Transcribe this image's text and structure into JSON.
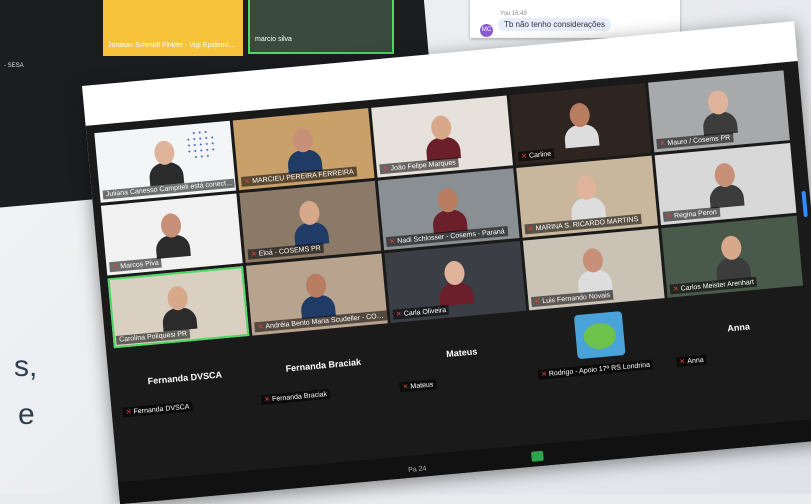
{
  "background": {
    "thumb1_label": "Jonatan Schmidt Finkler - Vigi Epidemi...",
    "thumb2_label": "marcio silva",
    "sesa_label": "- SESA",
    "left_text_line1": "s,",
    "left_text_line2": "e",
    "chat_small": "You 16:49",
    "chat_message": "Tb não tenho considerações",
    "chat_avatar": "MC"
  },
  "participants": [
    {
      "name": "Juliana Canesso Campiteli está conect...",
      "mic_muted": false,
      "type": "logo"
    },
    {
      "name": "MARCIEU PEREIRA FERREIRA",
      "mic_muted": true,
      "type": "video"
    },
    {
      "name": "João Felipe Marques",
      "mic_muted": true,
      "type": "video"
    },
    {
      "name": "Carline",
      "mic_muted": true,
      "type": "video"
    },
    {
      "name": "Mauro / Cosems PR",
      "mic_muted": true,
      "type": "video"
    },
    {
      "name": "Marcos Piva",
      "mic_muted": true,
      "type": "video"
    },
    {
      "name": "Eloá - COSEMS PR",
      "mic_muted": true,
      "type": "video"
    },
    {
      "name": "Nadi Schlosser - Cosems - Paraná",
      "mic_muted": true,
      "type": "video"
    },
    {
      "name": "MARINA S. RICARDO MARTINS",
      "mic_muted": true,
      "type": "video"
    },
    {
      "name": "Regina Peron",
      "mic_muted": true,
      "type": "video"
    },
    {
      "name": "Carolina Poliquesi PR",
      "mic_muted": false,
      "type": "video"
    },
    {
      "name": "Andréia Bento Maria Scudeller - COSE...",
      "mic_muted": true,
      "type": "video"
    },
    {
      "name": "Carla Oliveira",
      "mic_muted": true,
      "type": "video"
    },
    {
      "name": "Luis Fernando Novais",
      "mic_muted": true,
      "type": "video"
    },
    {
      "name": "Carlos Meister Arenhart",
      "mic_muted": true,
      "type": "video"
    },
    {
      "name": "Fernanda DVSCA",
      "mic_muted": true,
      "type": "plain",
      "display": "Fernanda DVSCA"
    },
    {
      "name": "Fernanda Braciak",
      "mic_muted": true,
      "type": "plain",
      "display": "Fernanda Braciak"
    },
    {
      "name": "Mateus",
      "mic_muted": true,
      "type": "plain",
      "display": "Mateus"
    },
    {
      "name": "Rodrigo - Apoio 17ª RS Londrina",
      "mic_muted": true,
      "type": "avatar"
    },
    {
      "name": "Anna",
      "mic_muted": true,
      "type": "plain",
      "display": "Anna"
    }
  ],
  "toolbar": {
    "item1": "Pa 24"
  },
  "colors": {
    "active_speaker": "#4cd964",
    "muted_mic": "#e0433b",
    "zoom_blue": "#2d8cff"
  }
}
